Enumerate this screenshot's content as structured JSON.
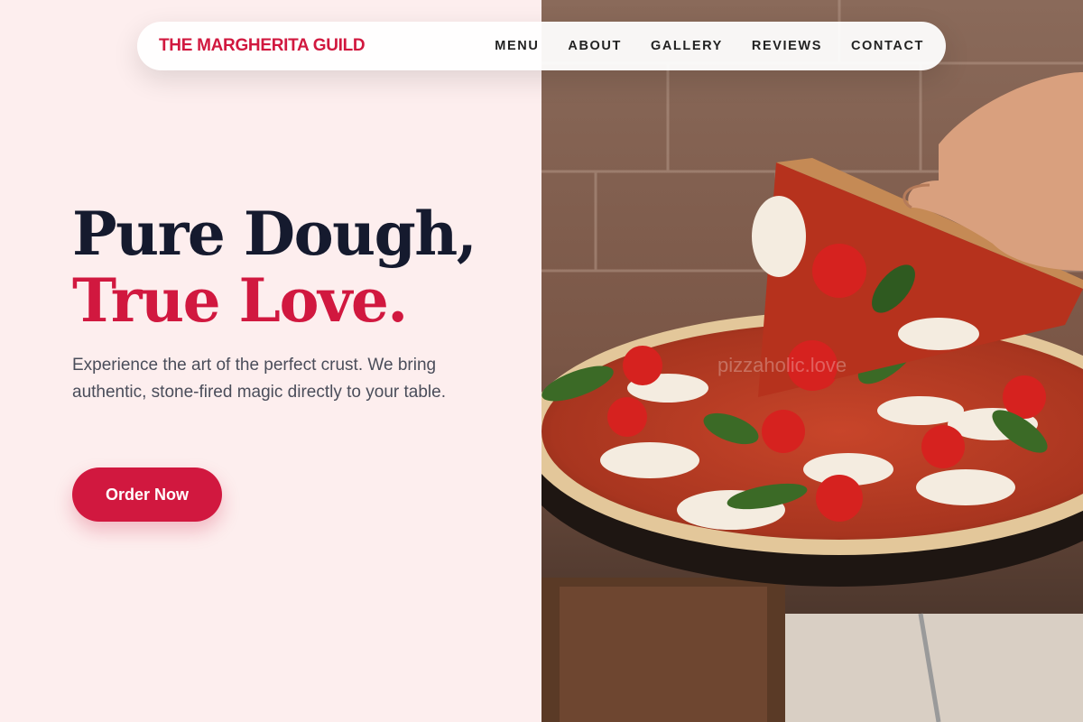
{
  "brand": {
    "name": "THE MARGHERITA GUILD",
    "accent_color": "#d1183f"
  },
  "nav": {
    "items": [
      {
        "label": "MENU"
      },
      {
        "label": "ABOUT"
      },
      {
        "label": "GALLERY"
      },
      {
        "label": "REVIEWS"
      },
      {
        "label": "CONTACT"
      }
    ]
  },
  "hero": {
    "headline_line1": "Pure Dough,",
    "headline_line2": "True Love.",
    "description": "Experience the art of the perfect crust. We bring authentic, stone-fired magic directly to your table.",
    "cta_label": "Order Now",
    "image_watermark": "pizzaholic.love",
    "image_alt": "Hand lifting a slice of margherita pizza with basil and cherry tomatoes"
  },
  "colors": {
    "background": "#fdeeee",
    "headline_dark": "#151a2e",
    "headline_accent": "#d1183f",
    "body_text": "#4a4d5a"
  }
}
